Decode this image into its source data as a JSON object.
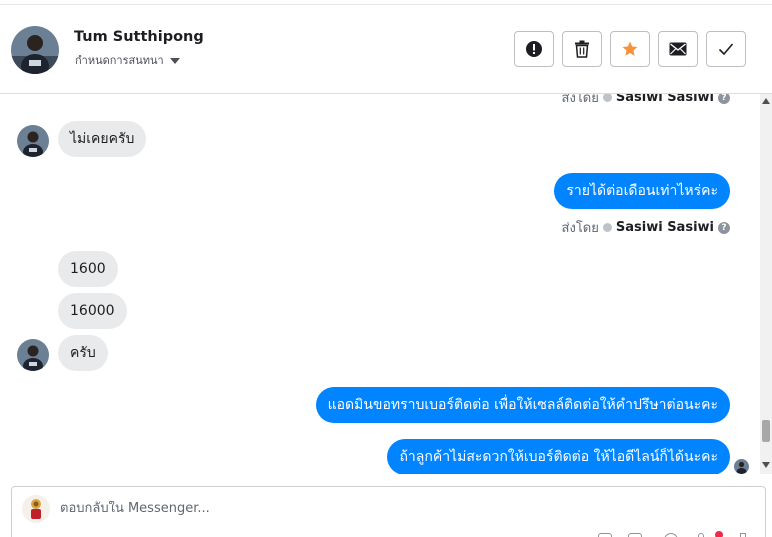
{
  "header": {
    "contact_name": "Tum Sutthipong",
    "conversation_options": "กำหนดการสนทนา",
    "actions": [
      {
        "name": "report",
        "icon": "exclamation-icon"
      },
      {
        "name": "delete",
        "icon": "trash-icon"
      },
      {
        "name": "star",
        "icon": "star-icon"
      },
      {
        "name": "mark-unread",
        "icon": "envelope-icon"
      },
      {
        "name": "mark-done",
        "icon": "check-icon"
      }
    ]
  },
  "messages": [
    {
      "id": "m0",
      "type": "sent_by",
      "prefix": "ส่งโดย",
      "sender": "Sasiwi Sasiwi"
    },
    {
      "id": "m1",
      "type": "in",
      "text": "ไม่เคยครับ"
    },
    {
      "id": "m2",
      "type": "out",
      "text": "รายได้ต่อเดือนเท่าไหร่คะ"
    },
    {
      "id": "m3",
      "type": "sent_by",
      "prefix": "ส่งโดย",
      "sender": "Sasiwi Sasiwi"
    },
    {
      "id": "m4",
      "type": "in",
      "text": "1600"
    },
    {
      "id": "m5",
      "type": "in",
      "text": "16000"
    },
    {
      "id": "m6",
      "type": "in",
      "text": "ครับ"
    },
    {
      "id": "m7",
      "type": "out",
      "text": "แอดมินขอทราบเบอร์ติดต่อ เพื่อให้เซลล์ติดต่อให้คำปรึษาต่อนะคะ"
    },
    {
      "id": "m8",
      "type": "out",
      "text": "ถ้าลูกค้าไม่สะดวกให้เบอร์ติดต่อ ให้ไอดีไลน์ก็ได้นะคะ"
    }
  ],
  "composer": {
    "placeholder": "ตอบกลับใน Messenger..."
  },
  "colors": {
    "accent": "#0084ff",
    "incoming_bubble": "#e9eaeb",
    "star": "#f7923a"
  }
}
